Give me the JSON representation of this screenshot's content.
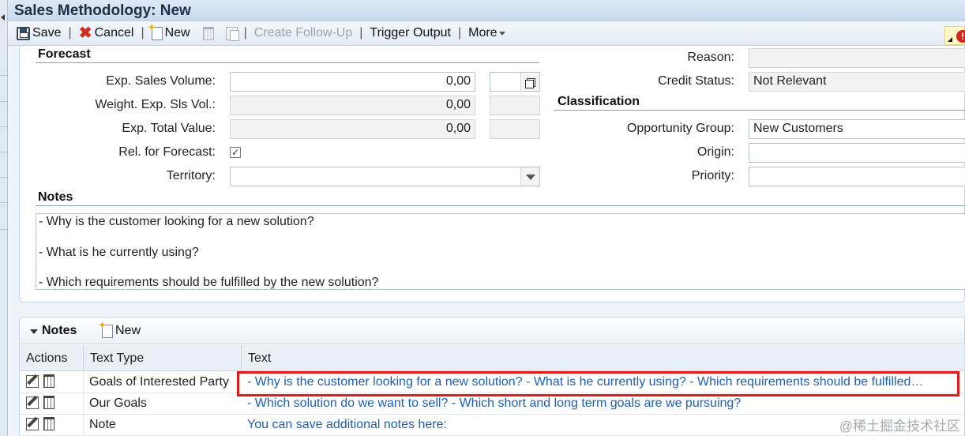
{
  "window": {
    "title": "Sales Methodology: New"
  },
  "toolbar": {
    "save": "Save",
    "cancel": "Cancel",
    "new": "New",
    "create_follow_up": "Create Follow-Up",
    "trigger_output": "Trigger Output",
    "more": "More"
  },
  "forecast": {
    "heading": "Forecast",
    "exp_sales_volume": {
      "label": "Exp. Sales Volume:",
      "value": "0,00",
      "unit": ""
    },
    "weight_exp_sls_vol": {
      "label": "Weight. Exp. Sls Vol.:",
      "value": "0,00",
      "unit": ""
    },
    "exp_total_value": {
      "label": "Exp. Total Value:",
      "value": "0,00",
      "unit": ""
    },
    "rel_for_forecast": {
      "label": "Rel. for Forecast:",
      "checked": true
    },
    "territory": {
      "label": "Territory:",
      "value": ""
    }
  },
  "status": {
    "reason": {
      "label": "Reason:",
      "value": ""
    },
    "credit_status": {
      "label": "Credit Status:",
      "value": "Not Relevant"
    }
  },
  "classification": {
    "heading": "Classification",
    "opportunity_group": {
      "label": "Opportunity Group:",
      "value": "New Customers"
    },
    "origin": {
      "label": "Origin:",
      "value": ""
    },
    "priority": {
      "label": "Priority:",
      "value": ""
    }
  },
  "notes": {
    "heading": "Notes",
    "lines": [
      "- Why is the customer looking for a new solution?",
      "- What is he currently using?",
      "- Which requirements should be fulfilled by the new solution?"
    ]
  },
  "notes_block": {
    "title": "Notes",
    "new": "New",
    "columns": [
      "Actions",
      "Text Type",
      "Text"
    ],
    "rows": [
      {
        "text_type": "Goals of Interested Party",
        "text": "- Why is the customer looking for a new solution? - What is he currently using? - Which requirements should be fulfilled…"
      },
      {
        "text_type": "Our Goals",
        "text": "- Which solution do we want to sell? - Which short and long term goals are we pursuing?"
      },
      {
        "text_type": "Note",
        "text": "You can save additional notes here:"
      }
    ]
  },
  "watermark": "@稀土掘金技术社区",
  "colors": {
    "highlight": "#e21b1b",
    "link": "#1d5fb8",
    "section_line": "#7ea0c4"
  }
}
